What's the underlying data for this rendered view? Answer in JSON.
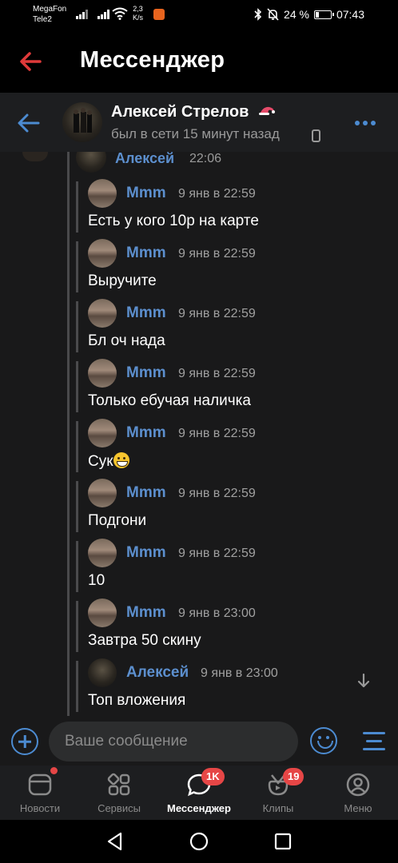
{
  "status_bar": {
    "carrier1": "MegaFon",
    "carrier2": "Tele2",
    "speed_value": "2,3",
    "speed_unit": "K/s",
    "battery_pct": "24 %",
    "battery_level": 0.24,
    "time": "07:43"
  },
  "header": {
    "title": "Мессенджер"
  },
  "chat": {
    "name": "Алексей Стрелов",
    "status": "был в сети 15 минут назад"
  },
  "partial_message": {
    "sender": "Алексей",
    "time": "22:06"
  },
  "forwarded": [
    {
      "sender": "Mmm",
      "time": "9 янв в 22:59",
      "text": "Есть у кого 10р на карте"
    },
    {
      "sender": "Mmm",
      "time": "9 янв в 22:59",
      "text": "Выручите"
    },
    {
      "sender": "Mmm",
      "time": "9 янв в 22:59",
      "text": "Бл оч нада"
    },
    {
      "sender": "Mmm",
      "time": "9 янв в 22:59",
      "text": "Только ебучая наличка"
    },
    {
      "sender": "Mmm",
      "time": "9 янв в 22:59",
      "text": "Сук"
    },
    {
      "sender": "Mmm",
      "time": "9 янв в 22:59",
      "text": "Подгони"
    },
    {
      "sender": "Mmm",
      "time": "9 янв в 22:59",
      "text": "10"
    },
    {
      "sender": "Mmm",
      "time": "9 янв в 23:00",
      "text": "Завтра 50 скину"
    },
    {
      "sender": "Алексей",
      "time": "9 янв в 23:00",
      "text": "Топ вложения"
    }
  ],
  "composer": {
    "placeholder": "Ваше сообщение"
  },
  "bottom_nav": {
    "items": [
      {
        "label": "Новости",
        "icon": "news-icon"
      },
      {
        "label": "Сервисы",
        "icon": "services-icon"
      },
      {
        "label": "Мессенджер",
        "icon": "messenger-icon",
        "badge": "1K"
      },
      {
        "label": "Клипы",
        "icon": "clips-icon",
        "badge": "19"
      },
      {
        "label": "Меню",
        "icon": "profile-icon"
      }
    ]
  },
  "colors": {
    "accent": "#4c8bd1",
    "sender_name": "#5c8fce",
    "badge": "#e64646",
    "header_back": "#e03a3a"
  }
}
